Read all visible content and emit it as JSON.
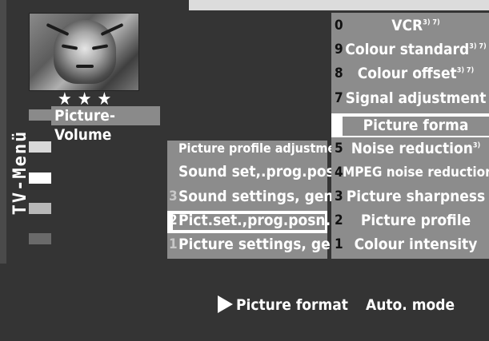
{
  "side_menu": {
    "vertical_title": "TV-Menü",
    "picture_volume_label": "Picture-Volume",
    "stars": "★★★"
  },
  "mid_menu": [
    {
      "num": "",
      "label": "Picture profile adjustment"
    },
    {
      "num": "",
      "label": "Sound set,.prog.posn"
    },
    {
      "num": "3",
      "label": "Sound settings, gen."
    },
    {
      "num": "2",
      "label": "Pict.set.,prog.posn."
    },
    {
      "num": "1",
      "label": "Picture settings, gen."
    }
  ],
  "right_menu": [
    {
      "num": "0",
      "label": "VCR",
      "sup": "3) 7)"
    },
    {
      "num": "9",
      "label": "Colour standard",
      "sup": "3) 7)"
    },
    {
      "num": "8",
      "label": "Colour offset",
      "sup": "3) 7)"
    },
    {
      "num": "7",
      "label": "Signal adjustment",
      "sup": ""
    },
    {
      "num": "",
      "label": "Picture forma",
      "sup": ""
    },
    {
      "num": "5",
      "label": "Noise reduction",
      "sup": "3)"
    },
    {
      "num": "4",
      "label": "MPEG noise reduction",
      "sup": ""
    },
    {
      "num": "3",
      "label": "Picture sharpness",
      "sup": ""
    },
    {
      "num": "2",
      "label": "Picture profile",
      "sup": ""
    },
    {
      "num": "1",
      "label": "Colour intensity",
      "sup": ""
    }
  ],
  "status": {
    "label": "Picture format",
    "value": "Auto. mode"
  },
  "colors": {
    "background": "#343434",
    "menu_panel": "#8c8c8c",
    "highlight": "#ffffff",
    "text": "#ffffff"
  },
  "icons": {
    "status_arrow": "play-arrow-icon",
    "side_item": "menu-square-icon"
  }
}
